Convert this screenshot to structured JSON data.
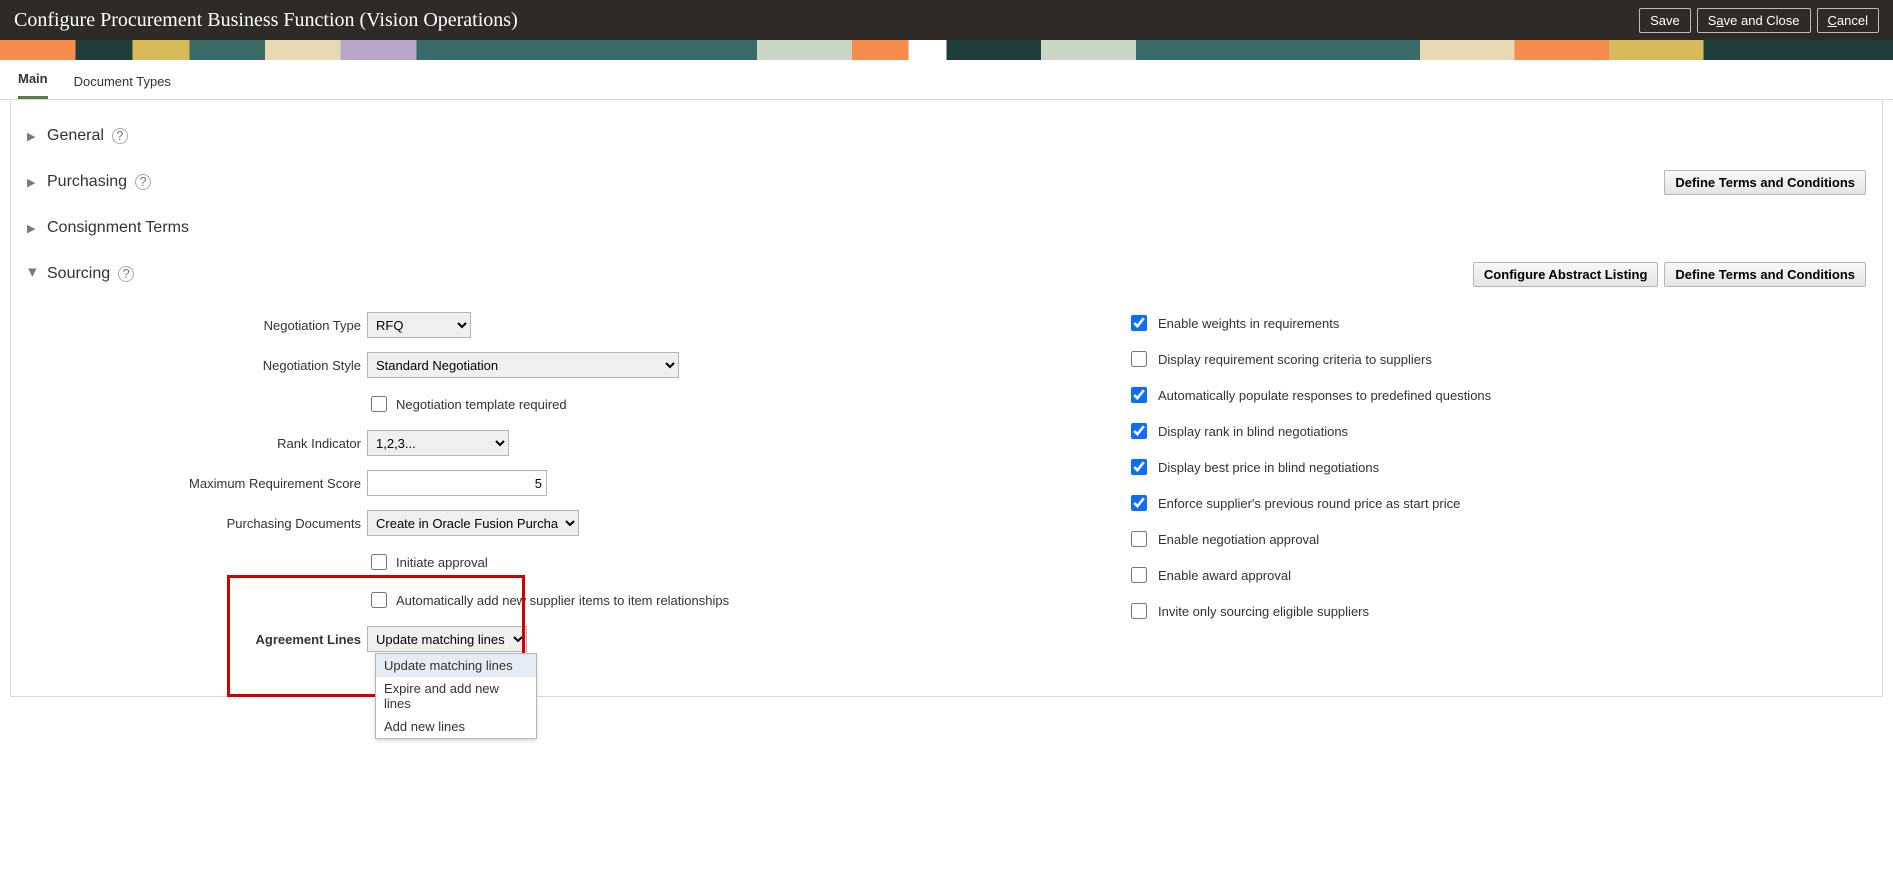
{
  "header": {
    "title": "Configure Procurement Business Function (Vision Operations)",
    "save": "Save",
    "save_close_pre": "S",
    "save_close_mn": "a",
    "save_close_post": "ve and Close",
    "cancel_mn": "C",
    "cancel_post": "ancel"
  },
  "tabs": {
    "main": "Main",
    "doc_types": "Document Types"
  },
  "sections": {
    "general": "General",
    "purchasing": "Purchasing",
    "consignment": "Consignment Terms",
    "sourcing": "Sourcing"
  },
  "buttons": {
    "define_tc1": "Define Terms and Conditions",
    "configure_abstract": "Configure Abstract Listing",
    "define_tc2": "Define Terms and Conditions"
  },
  "labels": {
    "negotiation_type": "Negotiation Type",
    "negotiation_style": "Negotiation Style",
    "negotiation_template_required": "Negotiation template required",
    "rank_indicator": "Rank Indicator",
    "max_req_score": "Maximum Requirement Score",
    "purchasing_docs": "Purchasing Documents",
    "initiate_approval": "Initiate approval",
    "auto_add_supplier": "Automatically add new supplier items to item relationships",
    "agreement_lines": "Agreement Lines"
  },
  "values": {
    "negotiation_type": "RFQ",
    "negotiation_style": "Standard Negotiation",
    "rank_indicator": "1,2,3...",
    "max_req_score": "5",
    "purchasing_docs": "Create in Oracle Fusion Purchasing",
    "agreement_lines": "Update matching lines"
  },
  "agreement_options": [
    "Update matching lines",
    "Expire and add new lines",
    "Add new lines"
  ],
  "right_checks": {
    "enable_weights": "Enable weights in requirements",
    "display_scoring": "Display requirement scoring criteria to suppliers",
    "auto_populate": "Automatically populate responses to predefined questions",
    "display_rank": "Display rank in blind negotiations",
    "display_best_price": "Display best price in blind negotiations",
    "enforce_prev_price": "Enforce supplier's previous round price as start price",
    "enable_neg_approval": "Enable negotiation approval",
    "enable_award_approval": "Enable award approval",
    "invite_only": "Invite only sourcing eligible suppliers"
  },
  "right_checked": {
    "enable_weights": true,
    "display_scoring": false,
    "auto_populate": true,
    "display_rank": true,
    "display_best_price": true,
    "enforce_prev_price": true,
    "enable_neg_approval": false,
    "enable_award_approval": false,
    "invite_only": false
  }
}
